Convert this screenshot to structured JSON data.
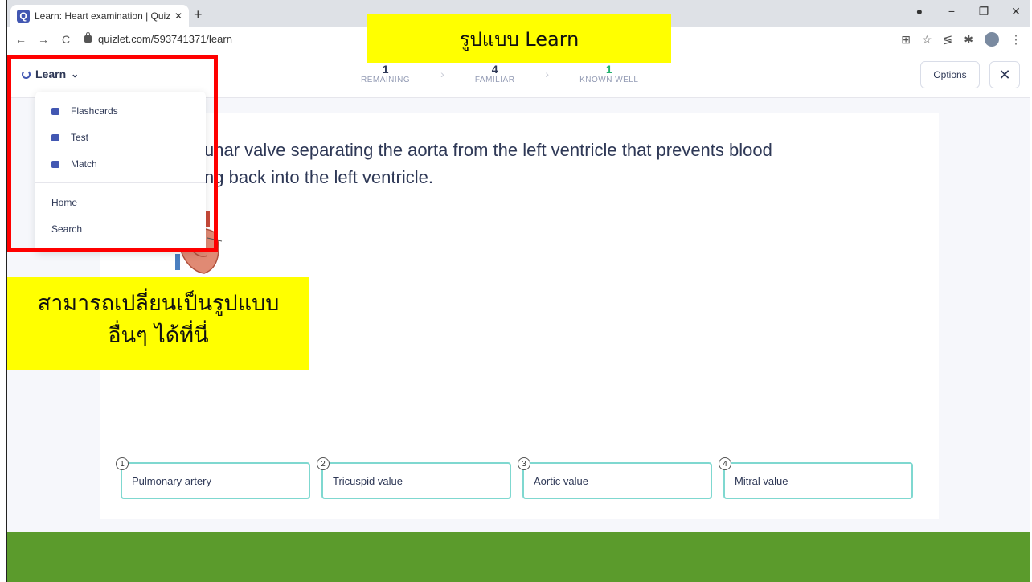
{
  "browser": {
    "tab_title": "Learn: Heart examination | Quizle",
    "tab_favicon": "Q",
    "tab_close": "✕",
    "new_tab": "+",
    "url": "quizlet.com/593741371/learn",
    "nav": {
      "back": "←",
      "forward": "→",
      "reload": "C"
    },
    "window_controls": {
      "minimize": "−",
      "maximize": "❐",
      "close": "✕"
    }
  },
  "header": {
    "mode_label": "Learn",
    "progress": [
      {
        "count": "1",
        "label": "REMAINING"
      },
      {
        "count": "4",
        "label": "FAMILIAR"
      },
      {
        "count": "1",
        "label": "KNOWN WELL"
      }
    ],
    "options_label": "Options",
    "close_label": "✕"
  },
  "dropdown": {
    "modes": [
      "Flashcards",
      "Test",
      "Match"
    ],
    "links": [
      "Home",
      "Search"
    ]
  },
  "question": {
    "line1": "unar valve separating the aorta from the left ventricle that prevents blood",
    "line2": "ng back into the left ventricle."
  },
  "answers": [
    {
      "num": "1",
      "text": "Pulmonary artery"
    },
    {
      "num": "2",
      "text": "Tricuspid value"
    },
    {
      "num": "3",
      "text": "Aortic value"
    },
    {
      "num": "4",
      "text": "Mitral value"
    }
  ],
  "annotations": {
    "top_label": "รูปแบบ Learn",
    "left_label_line1": "สามารถเปลี่ยนเป็นรูปแบบ",
    "left_label_line2": "อื่นๆ ได้ที่นี่"
  },
  "colors": {
    "accent": "#4257b2",
    "known_well": "#23b26d",
    "answer_border": "#7fd8d0",
    "highlight": "#ffff00",
    "annotation_box": "#ff0000",
    "footer": "#5b9b2c"
  }
}
